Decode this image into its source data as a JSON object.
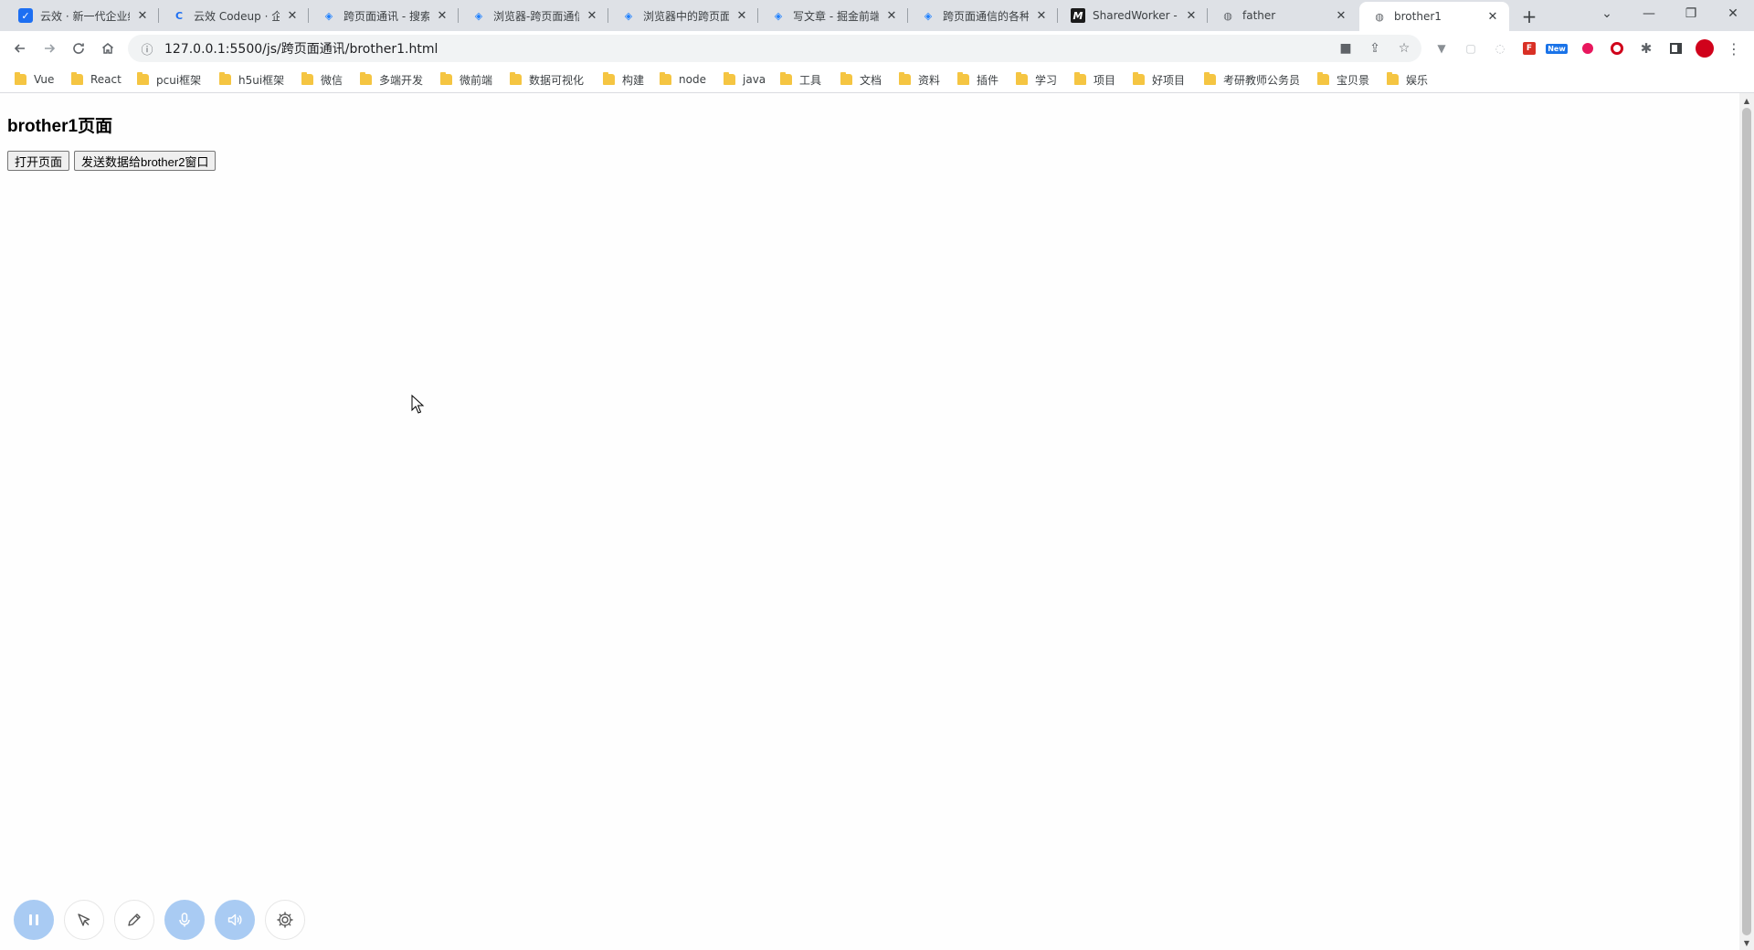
{
  "tabs": [
    {
      "title": "云效 · 新一代企业级",
      "favicon": "yunxiao-icon"
    },
    {
      "title": "云效 Codeup · 企业",
      "favicon": "codeup-icon"
    },
    {
      "title": "跨页面通讯 - 搜索",
      "favicon": "juejin-icon"
    },
    {
      "title": "浏览器-跨页面通信",
      "favicon": "juejin-icon"
    },
    {
      "title": "浏览器中的跨页面",
      "favicon": "juejin-icon"
    },
    {
      "title": "写文章 - 掘金前端",
      "favicon": "juejin-icon"
    },
    {
      "title": "跨页面通信的各种",
      "favicon": "juejin-icon"
    },
    {
      "title": "SharedWorker - W",
      "favicon": "mdn-icon"
    },
    {
      "title": "father",
      "favicon": "globe-icon"
    },
    {
      "title": "brother1",
      "favicon": "globe-icon",
      "active": true
    }
  ],
  "address": {
    "url": "127.0.0.1:5500/js/跨页面通讯/brother1.html"
  },
  "extensions": {
    "new_badge": "New"
  },
  "bookmarks": [
    "Vue",
    "React",
    "pcui框架",
    "h5ui框架",
    "微信",
    "多端开发",
    "微前端",
    "数据可视化",
    "构建",
    "node",
    "java",
    "工具",
    "文档",
    "资料",
    "插件",
    "学习",
    "项目",
    "好项目",
    "考研教师公务员",
    "宝贝景",
    "娱乐"
  ],
  "page": {
    "title": "brother1页面",
    "open_button": "打开页面",
    "send_button": "发送数据给brother2窗口"
  },
  "colors": {
    "accent": "#1d6ff2",
    "recorder_blue": "#a9cbf3"
  }
}
